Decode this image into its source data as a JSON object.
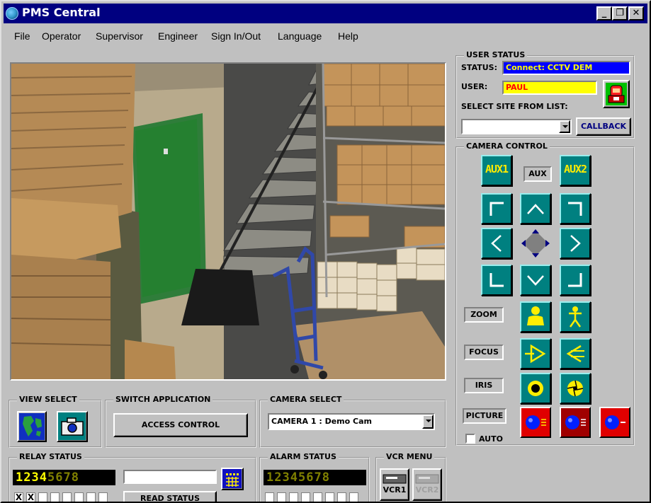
{
  "app": {
    "title": "PMS Central"
  },
  "menu": [
    "File",
    "Operator",
    "Supervisor",
    "Engineer",
    "Sign In/Out",
    "Language",
    "Help"
  ],
  "user_status": {
    "heading": "USER STATUS",
    "status_label": "STATUS:",
    "status_value": "Connect: CCTV DEM",
    "user_label": "USER:",
    "user_value": "PAUL",
    "site_label": "SELECT SITE FROM LIST:",
    "site_value": "",
    "callback_label": "CALLBACK"
  },
  "camera_control": {
    "heading": "CAMERA CONTROL",
    "aux1": "AUX1",
    "aux2": "AUX2",
    "aux_label": "AUX",
    "zoom_label": "ZOOM",
    "focus_label": "FOCUS",
    "iris_label": "IRIS",
    "picture_label": "PICTURE",
    "auto_label": "AUTO",
    "auto_checked": false
  },
  "view_select": {
    "heading": "VIEW SELECT"
  },
  "switch_app": {
    "heading": "SWITCH APPLICATION",
    "button": "ACCESS CONTROL"
  },
  "camera_select": {
    "heading": "CAMERA SELECT",
    "value": "CAMERA  1 : Demo Cam"
  },
  "relay_status": {
    "heading": "RELAY STATUS",
    "digits": [
      "1",
      "2",
      "3",
      "4",
      "5",
      "6",
      "7",
      "8"
    ],
    "active": [
      true,
      true,
      true,
      true,
      false,
      false,
      false,
      false
    ],
    "checks": [
      "X",
      "X",
      "",
      "",
      "",
      "",
      "",
      ""
    ],
    "read_button": "READ STATUS",
    "input_value": ""
  },
  "alarm_status": {
    "heading": "ALARM STATUS",
    "digits": [
      "1",
      "2",
      "3",
      "4",
      "5",
      "6",
      "7",
      "8"
    ],
    "checks": [
      "",
      "",
      "",
      "",
      "",
      "",
      "",
      ""
    ]
  },
  "vcr_menu": {
    "heading": "VCR MENU",
    "vcr1": "VCR1",
    "vcr2": "VCR2"
  },
  "colors": {
    "titlebar": "#000080",
    "status_bg": "#0000ff",
    "status_fg": "#ffff00",
    "user_bg": "#ffff00",
    "user_fg": "#ff0000",
    "teal": "#008080",
    "digit_on": "#ffff00",
    "digit_off": "#808000"
  }
}
